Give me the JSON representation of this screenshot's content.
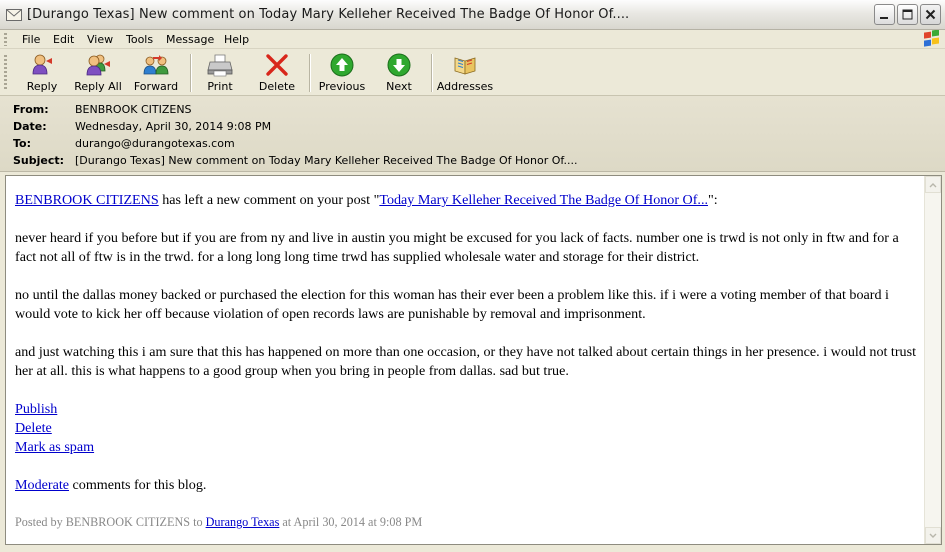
{
  "window": {
    "title": "[Durango Texas] New comment on Today Mary Kelleher Received The Badge Of Honor Of...."
  },
  "menu": {
    "items": [
      "File",
      "Edit",
      "View",
      "Tools",
      "Message",
      "Help"
    ]
  },
  "toolbar": {
    "reply": "Reply",
    "reply_all": "Reply All",
    "forward": "Forward",
    "print": "Print",
    "delete": "Delete",
    "previous": "Previous",
    "next": "Next",
    "addresses": "Addresses"
  },
  "header": {
    "from_label": "From:",
    "from": "BENBROOK CITIZENS",
    "date_label": "Date:",
    "date": "Wednesday, April 30, 2014 9:08 PM",
    "to_label": "To:",
    "to": "durango@durangotexas.com",
    "subject_label": "Subject:",
    "subject": "[Durango Texas] New comment on Today Mary Kelleher Received The Badge Of Honor Of...."
  },
  "message": {
    "author_link": "BENBROOK CITIZENS",
    "intro_text": " has left a new comment on your post \"",
    "post_link": "Today Mary Kelleher Received The Badge Of Honor Of...",
    "intro_end": "\":",
    "para1": "never heard if you before but if you are from ny and live in austin you might be excused for you lack of facts. number one is trwd is not only in ftw and for a fact not all of ftw is in the trwd. for a long long long time trwd has supplied wholesale water and storage for their district.",
    "para2": "no until the dallas money backed or purchased the election for this woman has their ever been a problem like this. if i were a voting member of that board i would vote to kick her off because violation of open records laws are punishable by removal and imprisonment.",
    "para3": "and just watching this i am sure that this has happened on more than one occasion, or they have not talked about certain things in her presence. i would not trust her at all. this is what happens to a good group when you bring in people from dallas. sad but true.",
    "publish_link": "Publish",
    "delete_link": "Delete",
    "spam_link": "Mark as spam",
    "moderate_link": "Moderate",
    "moderate_text": " comments for this blog.",
    "posted_prefix": "Posted by BENBROOK CITIZENS to ",
    "posted_blog_link": "Durango Texas",
    "posted_suffix": " at April 30, 2014 at 9:08 PM"
  },
  "colors": {
    "link": "#0000cc",
    "chrome": "#ece9d8",
    "delete_red": "#d8261b",
    "nav_green": "#2fa82f"
  },
  "icons": [
    "envelope-icon",
    "minimize-icon",
    "maximize-icon",
    "close-icon",
    "windows-logo-icon",
    "reply-icon",
    "reply-all-icon",
    "forward-icon",
    "printer-icon",
    "delete-x-icon",
    "previous-arrow-icon",
    "next-arrow-icon",
    "address-book-icon"
  ]
}
